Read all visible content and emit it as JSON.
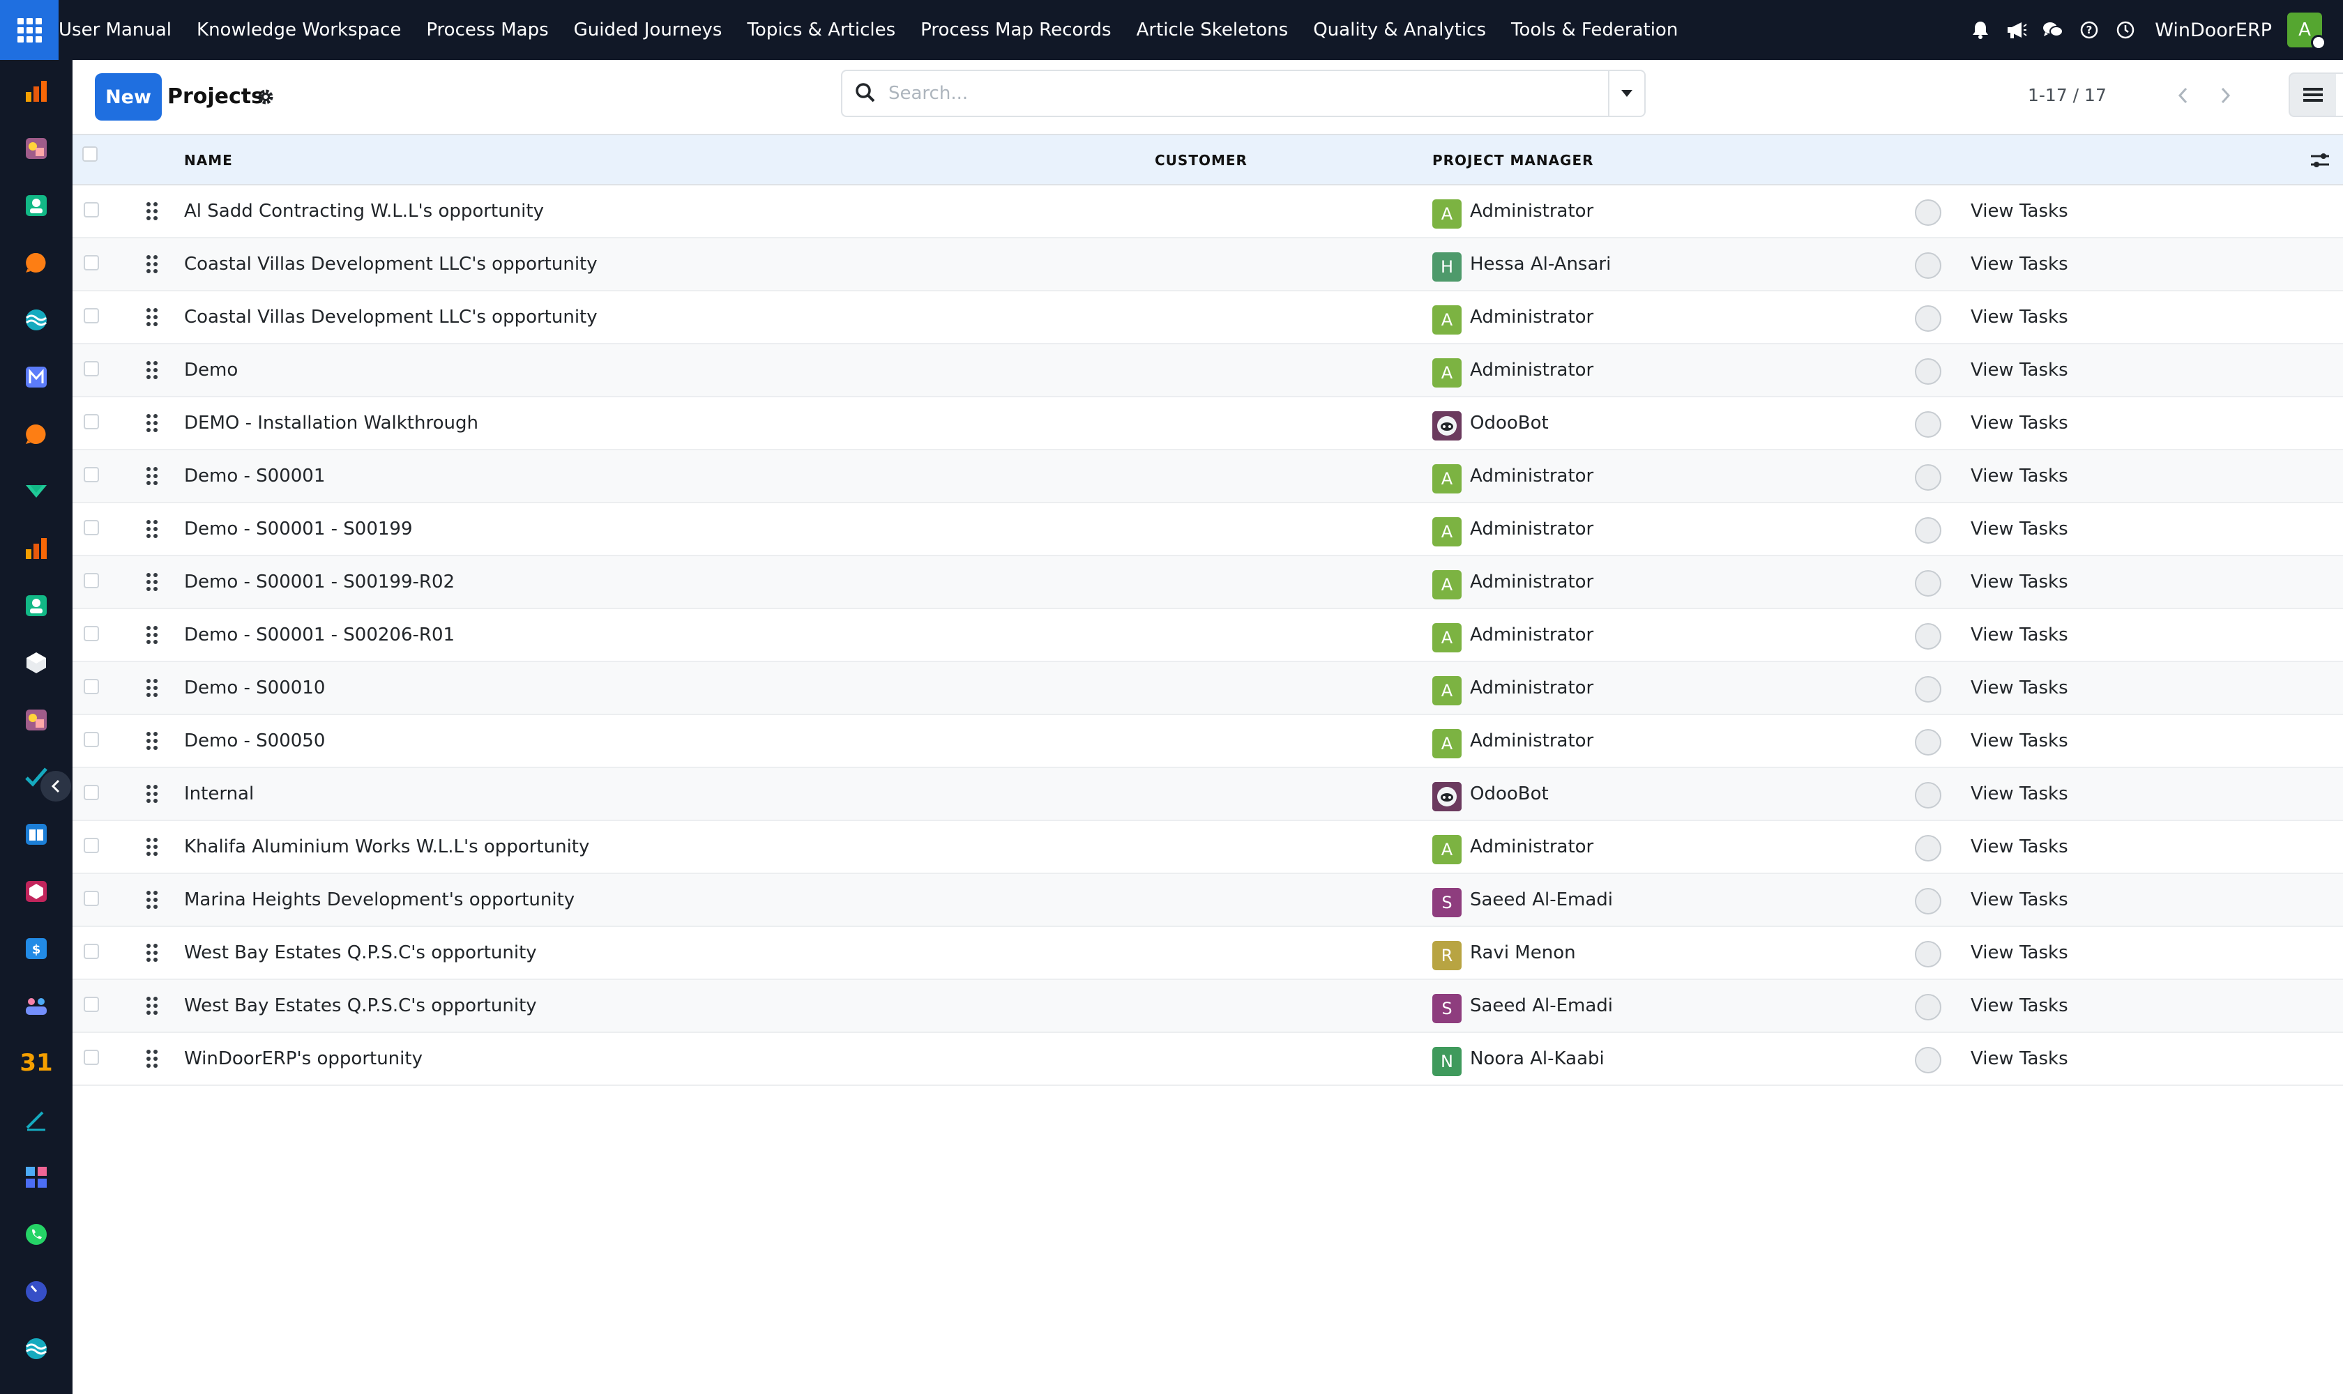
{
  "topbar": {
    "menu": [
      "User Manual",
      "Knowledge Workspace",
      "Process Maps",
      "Guided Journeys",
      "Topics & Articles",
      "Process Map Records",
      "Article Skeletons",
      "Quality & Analytics",
      "Tools & Federation"
    ],
    "company": "WinDoorERP",
    "user_initial": "A",
    "icons": [
      "bell-icon",
      "megaphone-icon",
      "chat-icon",
      "help-icon",
      "clock-icon"
    ]
  },
  "rail": {
    "icons": [
      "bar-chart-app-icon",
      "sketch-app-icon",
      "contacts-app-icon",
      "chat-bubble-app-icon",
      "wave-app-icon",
      "mail-app-icon",
      "chat-bubble-app-icon",
      "check-app-icon",
      "bar-chart-app-icon",
      "contacts-app-icon",
      "cube-app-icon",
      "sketch-app-icon",
      "tick-app-icon",
      "book-app-icon",
      "box-app-icon",
      "dollar-app-icon",
      "team-app-icon",
      "calendar-app-icon",
      "sign-app-icon",
      "dashboard-app-icon",
      "whatsapp-app-icon",
      "gauge-app-icon",
      "wave-app-icon"
    ],
    "calendar_label": "31"
  },
  "control": {
    "new_label": "New",
    "title": "Projects",
    "search_placeholder": "Search...",
    "search_value": "",
    "pager": "1-17 / 17"
  },
  "table": {
    "headers": {
      "name": "NAME",
      "customer": "CUSTOMER",
      "project_manager": "PROJECT MANAGER"
    },
    "view_tasks_label": "View Tasks",
    "colors": {
      "A": "#7cb342",
      "H": "#4e9a6b",
      "S": "#8e3d7e",
      "R": "#b8a442",
      "N": "#3f9a5c",
      "bot": "#6b3a5e"
    },
    "rows": [
      {
        "name": "Al Sadd Contracting W.L.L's opportunity",
        "customer": "",
        "pm": "Administrator",
        "initial": "A"
      },
      {
        "name": "Coastal Villas Development LLC's opportunity",
        "customer": "",
        "pm": "Hessa Al-Ansari",
        "initial": "H"
      },
      {
        "name": "Coastal Villas Development LLC's opportunity",
        "customer": "",
        "pm": "Administrator",
        "initial": "A"
      },
      {
        "name": "Demo",
        "customer": "",
        "pm": "Administrator",
        "initial": "A"
      },
      {
        "name": "DEMO - Installation Walkthrough",
        "customer": "",
        "pm": "OdooBot",
        "initial": "bot"
      },
      {
        "name": "Demo - S00001",
        "customer": "",
        "pm": "Administrator",
        "initial": "A"
      },
      {
        "name": "Demo - S00001 - S00199",
        "customer": "",
        "pm": "Administrator",
        "initial": "A"
      },
      {
        "name": "Demo - S00001 - S00199-R02",
        "customer": "",
        "pm": "Administrator",
        "initial": "A"
      },
      {
        "name": "Demo - S00001 - S00206-R01",
        "customer": "",
        "pm": "Administrator",
        "initial": "A"
      },
      {
        "name": "Demo - S00010",
        "customer": "",
        "pm": "Administrator",
        "initial": "A"
      },
      {
        "name": "Demo - S00050",
        "customer": "",
        "pm": "Administrator",
        "initial": "A"
      },
      {
        "name": "Internal",
        "customer": "",
        "pm": "OdooBot",
        "initial": "bot"
      },
      {
        "name": "Khalifa Aluminium Works W.L.L's opportunity",
        "customer": "",
        "pm": "Administrator",
        "initial": "A"
      },
      {
        "name": "Marina Heights Development's opportunity",
        "customer": "",
        "pm": "Saeed Al-Emadi",
        "initial": "S"
      },
      {
        "name": "West Bay Estates Q.P.S.C's opportunity",
        "customer": "",
        "pm": "Ravi Menon",
        "initial": "R"
      },
      {
        "name": "West Bay Estates Q.P.S.C's opportunity",
        "customer": "",
        "pm": "Saeed Al-Emadi",
        "initial": "S"
      },
      {
        "name": "WinDoorERP's opportunity",
        "customer": "",
        "pm": "Noora Al-Kaabi",
        "initial": "N"
      }
    ]
  }
}
